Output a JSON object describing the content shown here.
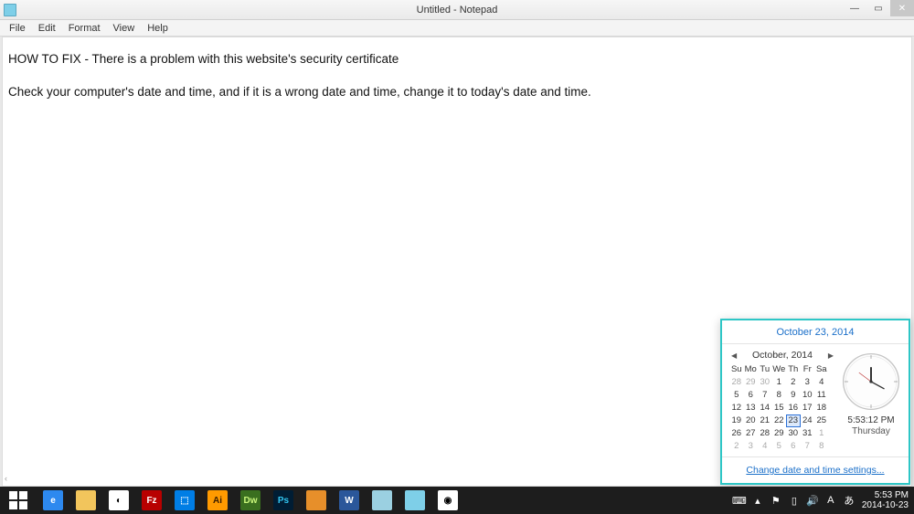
{
  "window": {
    "title": "Untitled - Notepad",
    "menu": [
      "File",
      "Edit",
      "Format",
      "View",
      "Help"
    ]
  },
  "document": {
    "line1": "HOW TO FIX - There is a problem with this website's security certificate",
    "line2": "Check your computer's date and time, and if it is a wrong date and time, change it to today's date and time."
  },
  "datetime_popup": {
    "date_full": "October 23, 2014",
    "month_label": "October, 2014",
    "dow": [
      "Su",
      "Mo",
      "Tu",
      "We",
      "Th",
      "Fr",
      "Sa"
    ],
    "grid": [
      {
        "d": "28",
        "m": true
      },
      {
        "d": "29",
        "m": true
      },
      {
        "d": "30",
        "m": true
      },
      {
        "d": "1"
      },
      {
        "d": "2"
      },
      {
        "d": "3"
      },
      {
        "d": "4"
      },
      {
        "d": "5"
      },
      {
        "d": "6"
      },
      {
        "d": "7"
      },
      {
        "d": "8"
      },
      {
        "d": "9"
      },
      {
        "d": "10"
      },
      {
        "d": "11"
      },
      {
        "d": "12"
      },
      {
        "d": "13"
      },
      {
        "d": "14"
      },
      {
        "d": "15"
      },
      {
        "d": "16"
      },
      {
        "d": "17"
      },
      {
        "d": "18"
      },
      {
        "d": "19"
      },
      {
        "d": "20"
      },
      {
        "d": "21"
      },
      {
        "d": "22"
      },
      {
        "d": "23",
        "t": true
      },
      {
        "d": "24"
      },
      {
        "d": "25"
      },
      {
        "d": "26"
      },
      {
        "d": "27"
      },
      {
        "d": "28"
      },
      {
        "d": "29"
      },
      {
        "d": "30"
      },
      {
        "d": "31"
      },
      {
        "d": "1",
        "m": true
      },
      {
        "d": "2",
        "m": true
      },
      {
        "d": "3",
        "m": true
      },
      {
        "d": "4",
        "m": true
      },
      {
        "d": "5",
        "m": true
      },
      {
        "d": "6",
        "m": true
      },
      {
        "d": "7",
        "m": true
      },
      {
        "d": "8",
        "m": true
      }
    ],
    "time": "5:53:12 PM",
    "day": "Thursday",
    "link": "Change date and time settings..."
  },
  "taskbar": {
    "apps": [
      {
        "name": "start",
        "bg": "transparent"
      },
      {
        "name": "ie",
        "bg": "#2d89ef",
        "txt": "e",
        "fg": "#fff"
      },
      {
        "name": "explorer",
        "bg": "#f2c55c",
        "txt": "",
        "fg": "#7a5515"
      },
      {
        "name": "chrome",
        "bg": "#fff",
        "txt": "◐",
        "fg": "#000"
      },
      {
        "name": "filezilla",
        "bg": "#b80000",
        "txt": "Fz",
        "fg": "#fff"
      },
      {
        "name": "dropbox",
        "bg": "#007ee5",
        "txt": "⬚",
        "fg": "#fff"
      },
      {
        "name": "illustrator",
        "bg": "#ff9a00",
        "txt": "Ai",
        "fg": "#3b1e00"
      },
      {
        "name": "dreamweaver",
        "bg": "#3a6f1f",
        "txt": "Dw",
        "fg": "#c9f77b"
      },
      {
        "name": "photoshop",
        "bg": "#001d34",
        "txt": "Ps",
        "fg": "#31c5f0"
      },
      {
        "name": "app1",
        "bg": "#e78f2a",
        "txt": "",
        "fg": "#fff"
      },
      {
        "name": "word",
        "bg": "#2b579a",
        "txt": "W",
        "fg": "#fff"
      },
      {
        "name": "doc",
        "bg": "#9bd0e1",
        "txt": "",
        "fg": "#fff"
      },
      {
        "name": "notepad",
        "bg": "#7ecfe8",
        "txt": "",
        "fg": "#fff"
      },
      {
        "name": "app2",
        "bg": "#fff",
        "txt": "◉",
        "fg": "#000"
      }
    ],
    "tray_icons": [
      "keyboard-icon",
      "up-icon",
      "flag-icon",
      "network-icon",
      "volume-icon",
      "lang-a-icon",
      "ime-icon"
    ],
    "clock_time": "5:53 PM",
    "clock_date": "2014-10-23"
  }
}
